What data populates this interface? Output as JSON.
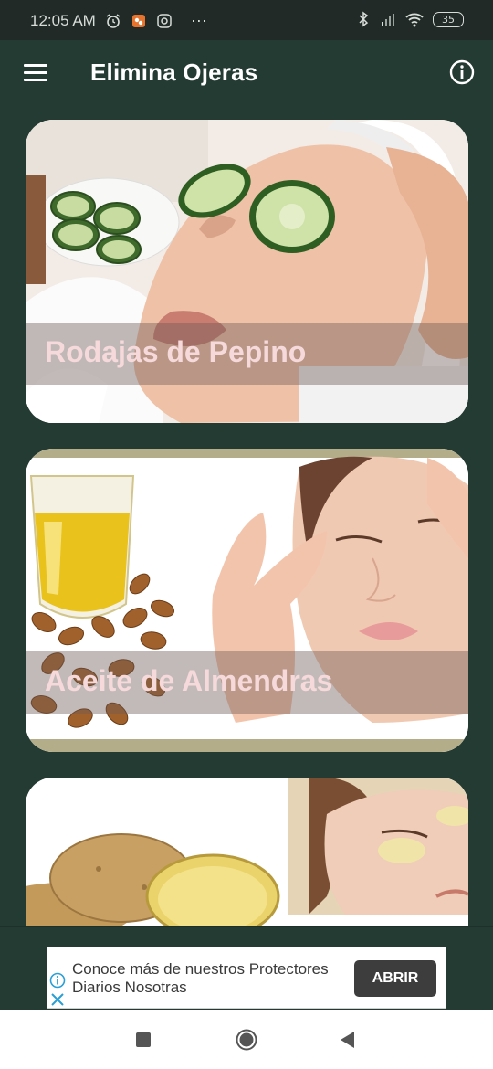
{
  "status_bar": {
    "time": "12:05 AM",
    "dots": "···",
    "battery": "35",
    "icons": [
      "alarm-icon",
      "app-notification-icon",
      "instagram-icon",
      "bluetooth-icon",
      "signal-icon",
      "wifi-icon",
      "battery-icon"
    ]
  },
  "app_bar": {
    "title": "Elimina Ojeras",
    "menu_icon": "hamburger-menu-icon",
    "info_icon": "info-icon"
  },
  "cards": [
    {
      "label": "Rodajas de Pepino",
      "image": "cucumber-eyes-photo"
    },
    {
      "label": "Aceite de Almendras",
      "image": "almond-oil-photo"
    },
    {
      "label": "",
      "image": "potato-eye-patches-photo"
    }
  ],
  "ad": {
    "text": "Conoce más de nuestros Protectores Diarios Nosotras",
    "button": "ABRIR"
  },
  "colors": {
    "background": "#243b33",
    "status_bar": "#222a27",
    "card_label": "#f6d9da",
    "ad_button": "#3d3d3d"
  }
}
